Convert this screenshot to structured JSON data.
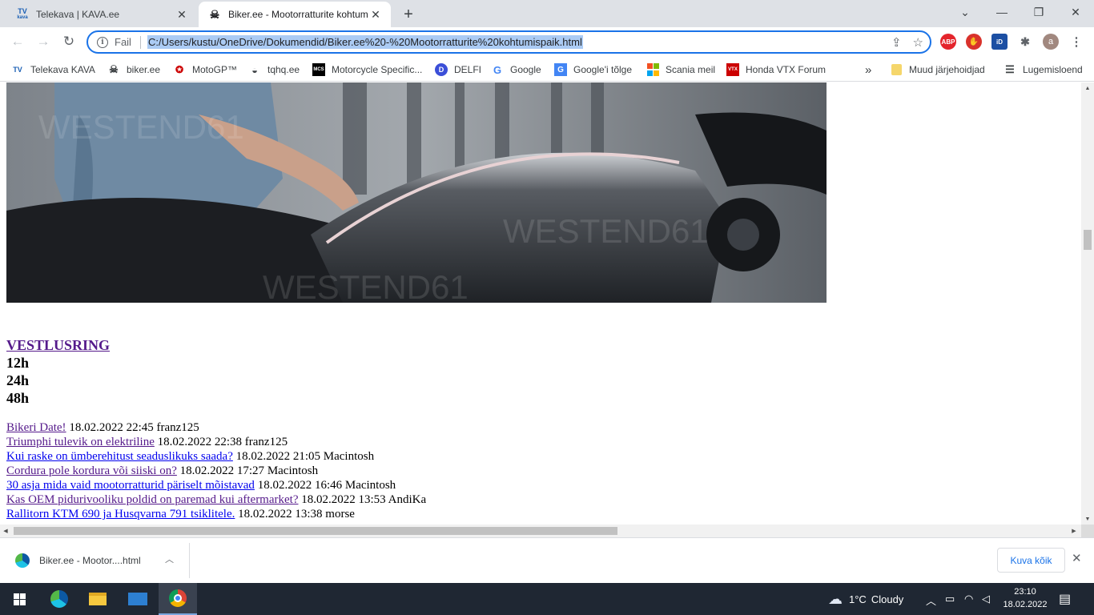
{
  "tabs": [
    {
      "title": "Telekava | KAVA.ee",
      "favicon": "TV",
      "favicon_sub": "kava",
      "active": false
    },
    {
      "title": "Biker.ee - Mootorratturite kohtumispaik",
      "active": true
    }
  ],
  "toolbar": {
    "info_label": "Fail",
    "url": "C:/Users/kustu/OneDrive/Dokumendid/Biker.ee%20-%20Mootorratturite%20kohtumispaik.html",
    "profile_initial": "a",
    "abp_label": "ABP",
    "id_label": "iD"
  },
  "bookmarks": [
    {
      "label": "Telekava  KAVA",
      "icon": "TV",
      "color": "#1a5fb4"
    },
    {
      "label": "biker.ee",
      "icon": "☠",
      "color": "#000000"
    },
    {
      "label": "MotoGP™",
      "icon": "✪",
      "color": "#cc0000"
    },
    {
      "label": "tqhq.ee",
      "icon": "◒",
      "color": "#444444"
    },
    {
      "label": "Motorcycle Specific...",
      "icon": "MCS",
      "color": "#000000"
    },
    {
      "label": "DELFI",
      "icon": "D",
      "color": "#3b4fd8"
    },
    {
      "label": "Google",
      "icon": "G",
      "color": "#4285f4"
    },
    {
      "label": "Google'i tõlge",
      "icon": "G",
      "color": "#4285f4"
    },
    {
      "label": "Scania meil",
      "icon": "▦",
      "color": "#f25022"
    },
    {
      "label": "Honda VTX Forum",
      "icon": "VTX",
      "color": "#cc0000"
    }
  ],
  "bookmarks_overflow": "»",
  "other_bookmarks": "Muud järjehoidjad",
  "reading_list": "Lugemisloend",
  "page": {
    "chat_heading": "VESTLUSRING",
    "periods": [
      "12h",
      "24h",
      "48h"
    ],
    "posts": [
      {
        "title": "Bikeri Date!",
        "date": "18.02.2022 22:45",
        "author": "franz125",
        "visited": true
      },
      {
        "title": "Triumphi tulevik on elektriline",
        "date": "18.02.2022 22:38",
        "author": "franz125",
        "visited": true
      },
      {
        "title": "Kui raske on ümberehitust seaduslikuks saada?",
        "date": "18.02.2022 21:05",
        "author": "Macintosh",
        "visited": false
      },
      {
        "title": "Cordura pole kordura või siiski on?",
        "date": "18.02.2022 17:27",
        "author": "Macintosh",
        "visited": true
      },
      {
        "title": "30 asja mida vaid mootorratturid päriselt mõistavad",
        "date": "18.02.2022 16:46",
        "author": "Macintosh",
        "visited": false
      },
      {
        "title": "Kas OEM pidurivooliku poldid on paremad kui aftermarket?",
        "date": "18.02.2022 13:53",
        "author": "AndiKa",
        "visited": true
      },
      {
        "title": "Rallitorn KTM 690 ja Husqvarna 791 tsiklitele.",
        "date": "18.02.2022 13:38",
        "author": "morse",
        "visited": false
      }
    ]
  },
  "download": {
    "filename": "Biker.ee - Mootor....html",
    "show_all": "Kuva kõik"
  },
  "taskbar": {
    "weather_temp": "1°C",
    "weather_desc": "Cloudy",
    "time": "23:10",
    "date": "18.02.2022"
  }
}
